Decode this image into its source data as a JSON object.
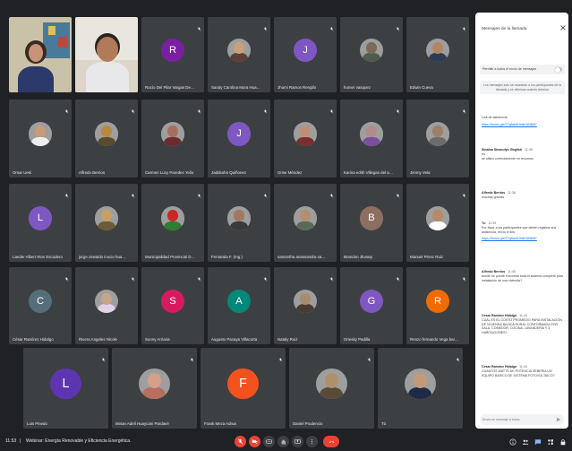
{
  "meeting": {
    "time": "11:53",
    "separator": "|",
    "title": "Webinar: Energía Renovable y Eficiencia Energética."
  },
  "colors": {
    "background": "#202124",
    "tile": "#3c4043",
    "hangup": "#ea4335",
    "mic_off": "#ea4335",
    "link": "#1a73e8"
  },
  "participants": [
    {
      "name": "",
      "kind": "camera",
      "scene": "woman-classroom"
    },
    {
      "name": "",
      "kind": "camera",
      "scene": "man-office"
    },
    {
      "name": "Rocío Del Pilar Vargas Delgado",
      "kind": "initial",
      "initial": "R",
      "color": "#7b1fa2"
    },
    {
      "name": "Sandy Carolina Mora Huarcaya",
      "kind": "photo",
      "face": "#c8a07e",
      "body": "#5d4037"
    },
    {
      "name": "Jhomi Ramos Rengifo",
      "kind": "initial",
      "initial": "J",
      "color": "#7e57c2"
    },
    {
      "name": "homer vasquez",
      "kind": "photo",
      "face": "#7a6a5a",
      "body": "#4e5b4e"
    },
    {
      "name": "Edwin Cueva",
      "kind": "photo",
      "face": "#b58563",
      "body": "#2e3b55"
    },
    {
      "name": "Omar Ueki",
      "kind": "photo",
      "face": "#c99b78",
      "body": "#eeeeee"
    },
    {
      "name": "Alfredo Berrios",
      "kind": "photo",
      "face": "#b98a3e",
      "body": "#5b4a2e"
    },
    {
      "name": "Carmen Lucy Paredes Yello",
      "kind": "photo",
      "face": "#a86f5a",
      "body": "#6d2b2b"
    },
    {
      "name": "Jaddsohn Quiñonez",
      "kind": "initial",
      "initial": "J",
      "color": "#7e57c2"
    },
    {
      "name": "Grise Méndez",
      "kind": "photo",
      "face": "#c08f73",
      "body": "#7a2e2e"
    },
    {
      "name": "Karina edith Villegas del aguila",
      "kind": "photo",
      "face": "#b28a8a",
      "body": "#7b4f9d"
    },
    {
      "name": "Jimmy Vela",
      "kind": "photo",
      "face": "#9c8065",
      "body": "#6b6b6b"
    },
    {
      "name": "Lander Albert Rios Escudero",
      "kind": "initial",
      "initial": "L",
      "color": "#7e57c2"
    },
    {
      "name": "jorge oswaldo inocio huamaya",
      "kind": "photo",
      "face": "#c9a063",
      "body": "#6b5b3a"
    },
    {
      "name": "Municipalidad Provincial De ...",
      "kind": "photo",
      "face": "#c62828",
      "body": "#2e7d32"
    },
    {
      "name": "Fernanda F. (Ing.)",
      "kind": "photo",
      "face": "#a07860",
      "body": "#3a3a3a"
    },
    {
      "name": "samantha anassandra sanche...",
      "kind": "photo",
      "face": "#b09070",
      "body": "#5a6a5a"
    },
    {
      "name": "Brandon Jhosep",
      "kind": "initial",
      "initial": "B",
      "color": "#8d6e63"
    },
    {
      "name": "Manuel Pérez Ruiz",
      "kind": "photo",
      "face": "#b58a66",
      "body": "#ffffff"
    },
    {
      "name": "César Ramírez Hidalgo",
      "kind": "initial",
      "initial": "C",
      "color": "#546e7a"
    },
    {
      "name": "Rivera Angeles Nicole",
      "kind": "photo",
      "face": "#c7a48c",
      "body": "#e0d0e8"
    },
    {
      "name": "Sunny Arriaria",
      "kind": "initial",
      "initial": "S",
      "color": "#d81b60"
    },
    {
      "name": "Augusto Pacaya Villacorta",
      "kind": "initial",
      "initial": "A",
      "color": "#00897b"
    },
    {
      "name": "Nataly Ruiz",
      "kind": "photo",
      "face": "#a88a6e",
      "body": "#4a3a2e"
    },
    {
      "name": "Oriesky Padilla",
      "kind": "initial",
      "initial": "G",
      "color": "#7e57c2"
    },
    {
      "name": "Renzo fernando Vega barzales",
      "kind": "initial",
      "initial": "R",
      "color": "#ef6c00"
    },
    {
      "name": "Luis Pinedo",
      "kind": "initial",
      "initial": "L",
      "color": "#5e35b1"
    },
    {
      "name": "Mirian Adell Huaycani Pardavé",
      "kind": "photo",
      "face": "#d4a08a",
      "body": "#b76e5e"
    },
    {
      "name": "Frank Meza Adrua",
      "kind": "initial",
      "initial": "F",
      "color": "#f4511e"
    },
    {
      "name": "Daniel Prudencio",
      "kind": "photo",
      "face": "#b0906a",
      "body": "#5a4a3a"
    },
    {
      "name": "Tú",
      "kind": "photo",
      "face": "#c39a78",
      "body": "#1f2a44"
    }
  ],
  "chat": {
    "title": "Mensajes de la llamada",
    "toggle_label": "Permitir a todos el envío de mensajes",
    "notice": "Los mensajes solo se muestran a los participantes de la llamada y se eliminan cuando termina",
    "messages": [
      {
        "sender": "",
        "time": "",
        "text": "Link de asistencia",
        "link": "https://forms.gle/TYqNsMHhNiGtNBl87"
      },
      {
        "sender": "Sinaloa Sinacuiyu Gbglish",
        "time": "11:35",
        "text": "no\nse utilizó correctamente en recursos",
        "link": ""
      },
      {
        "sender": "Alfredo Berrios",
        "time": "11:36",
        "text": "muchas gracias",
        "link": ""
      },
      {
        "sender": "Tú",
        "time": "11:39",
        "text": "Por favor a los participantes que deben registrar sus asistencia, envío el link",
        "link": "https://forms.gle/TYqNsMHhNiGtNBl87"
      },
      {
        "sender": "Alfredo Berrios",
        "time": "11:40",
        "text": "donde se puede encontrar toda el sistema completo para instalación de una vivienda?",
        "link": ""
      },
      {
        "sender": "Cesar Ramirez Hidalgo",
        "time": "11:43",
        "text": "CUAL ES EL COSTO PROMEDIO PARA INSTALACIÓN DE VIVIENDA BASICA RURAL CONFORMADA POR SALA, COMEDOR, COCINA, LAVANDERÍA Y 3 HABITACIONES?",
        "link": ""
      },
      {
        "sender": "Cesar Ramirez Hidalgo",
        "time": "11:44",
        "text": "CUANTOS WATTS DE POTENCIA DEBERÍA UN EQUIPO BASICO DE SISTEMA FOTOVOLTAICO?",
        "link": ""
      }
    ],
    "input_placeholder": "Envía un mensaje a todos"
  },
  "controls": {
    "items": [
      {
        "name": "mic-off",
        "icon": "mic-off-icon"
      },
      {
        "name": "camera-off",
        "icon": "camera-off-icon"
      },
      {
        "name": "captions",
        "icon": "captions-icon"
      },
      {
        "name": "raise-hand",
        "icon": "hand-icon"
      },
      {
        "name": "present",
        "icon": "present-icon"
      },
      {
        "name": "more",
        "icon": "more-icon"
      },
      {
        "name": "hangup",
        "icon": "hangup-icon"
      }
    ],
    "right": [
      {
        "name": "info",
        "icon": "info-icon"
      },
      {
        "name": "people",
        "icon": "people-icon"
      },
      {
        "name": "chat",
        "icon": "chat-icon"
      },
      {
        "name": "activities",
        "icon": "activities-icon"
      },
      {
        "name": "lock",
        "icon": "lock-icon"
      }
    ]
  }
}
